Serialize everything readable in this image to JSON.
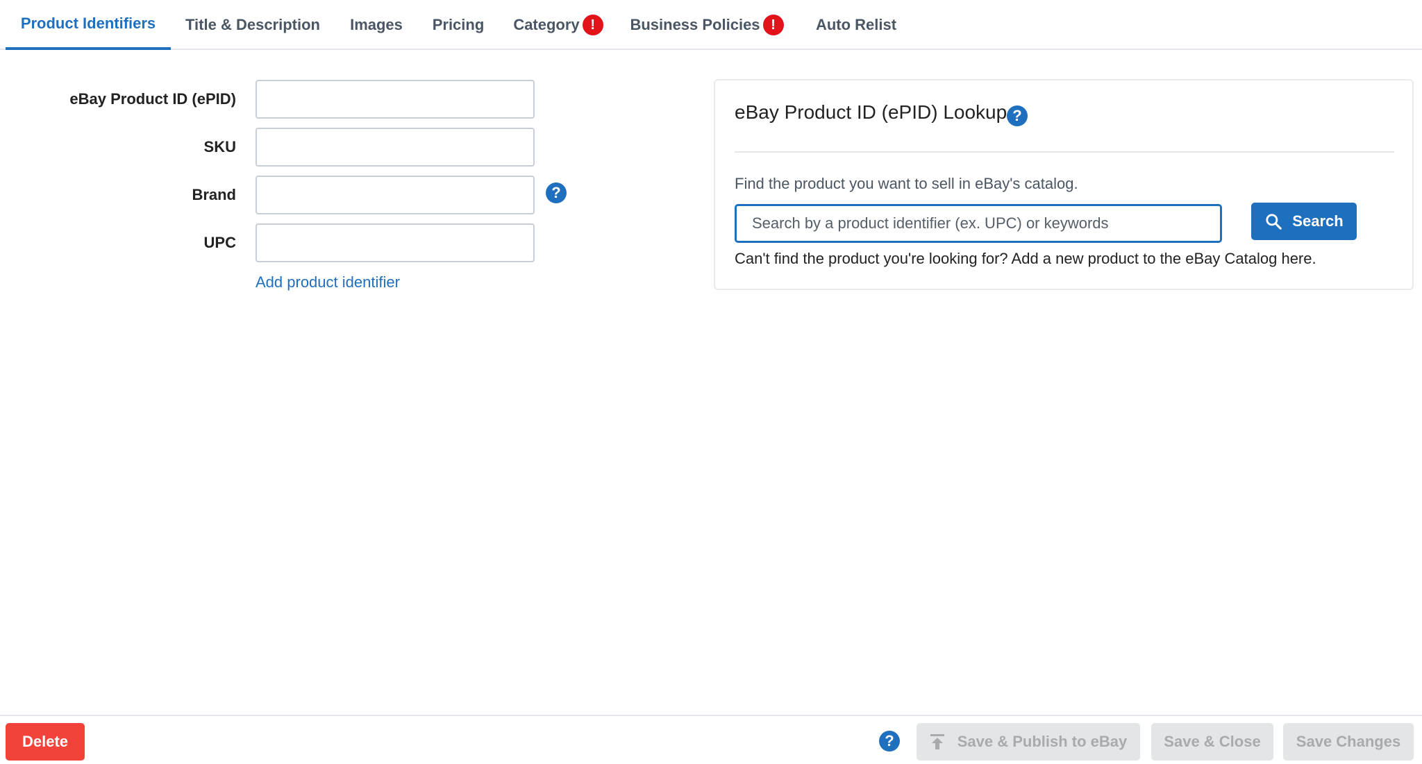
{
  "tabs": [
    {
      "label": "Product Identifiers",
      "active": true,
      "alert": false
    },
    {
      "label": "Title & Description",
      "active": false,
      "alert": false
    },
    {
      "label": "Images",
      "active": false,
      "alert": false
    },
    {
      "label": "Pricing",
      "active": false,
      "alert": false
    },
    {
      "label": "Category",
      "active": false,
      "alert": true
    },
    {
      "label": "Business Policies",
      "active": false,
      "alert": true
    },
    {
      "label": "Auto Relist",
      "active": false,
      "alert": false
    }
  ],
  "alert_symbol": "!",
  "form": {
    "fields": [
      {
        "label": "eBay Product ID (ePID)",
        "value": ""
      },
      {
        "label": "SKU",
        "value": ""
      },
      {
        "label": "Brand",
        "value": ""
      },
      {
        "label": "UPC",
        "value": ""
      }
    ],
    "add_identifier_link": "Add product identifier"
  },
  "help_symbol": "?",
  "lookup": {
    "title": "eBay Product ID (ePID) Lookup",
    "subtext": "Find the product you want to sell in eBay's catalog.",
    "search_placeholder": "Search by a product identifier (ex. UPC) or keywords",
    "search_value": "",
    "search_button_label": "Search",
    "cant_find_text": "Can't find the product you're looking for? Add a new product to the eBay Catalog here."
  },
  "footer": {
    "delete_label": "Delete",
    "publish_label": "Save & Publish to eBay",
    "save_close_label": "Save & Close",
    "save_changes_label": "Save Changes"
  },
  "colors": {
    "accent": "#1f6fbf",
    "alert": "#e3131c",
    "delete": "#f2433a",
    "disabled_bg": "#e4e5e6",
    "disabled_text": "#a8abae"
  }
}
